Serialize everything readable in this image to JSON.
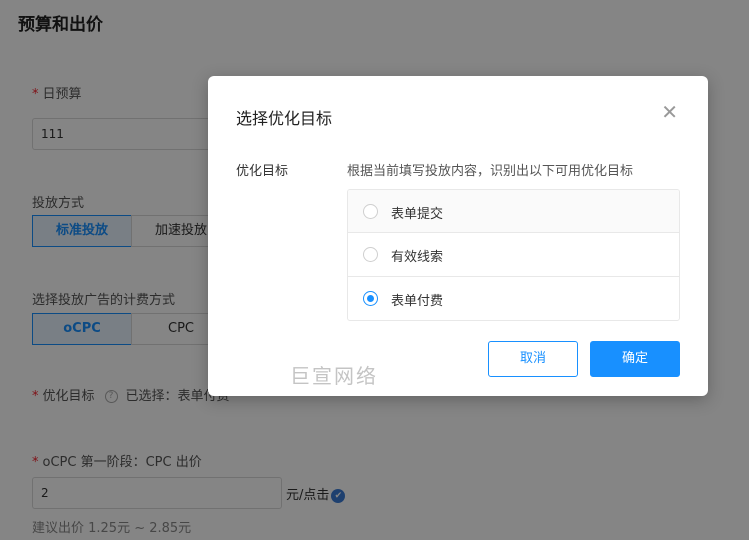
{
  "page": {
    "title": "预算和出价",
    "daily_budget": {
      "label": "日预算",
      "value": "111"
    },
    "delivery_mode": {
      "label": "投放方式",
      "options": [
        "标准投放",
        "加速投放"
      ],
      "selected": "标准投放"
    },
    "billing": {
      "label": "选择投放广告的计费方式",
      "options": [
        "oCPC",
        "CPC"
      ],
      "selected": "oCPC"
    },
    "optimization": {
      "label": "优化目标",
      "selected_prefix": "已选择：表单付费"
    },
    "ocpc_bid": {
      "label": "oCPC 第一阶段：CPC 出价",
      "value": "2",
      "unit": "元/点击",
      "suggestion": "建议出价 1.25元 ~ 2.85元"
    }
  },
  "modal": {
    "title": "选择优化目标",
    "field_label": "优化目标",
    "hint": "根据当前填写投放内容，识别出以下可用优化目标",
    "options": [
      {
        "label": "表单提交",
        "checked": false
      },
      {
        "label": "有效线索",
        "checked": false
      },
      {
        "label": "表单付费",
        "checked": true
      }
    ],
    "cancel_label": "取消",
    "ok_label": "确定"
  },
  "watermark": "巨宣网络",
  "colors": {
    "primary": "#1890ff",
    "required": "#f5222d",
    "overlay": "rgba(0,0,0,0.48)"
  }
}
